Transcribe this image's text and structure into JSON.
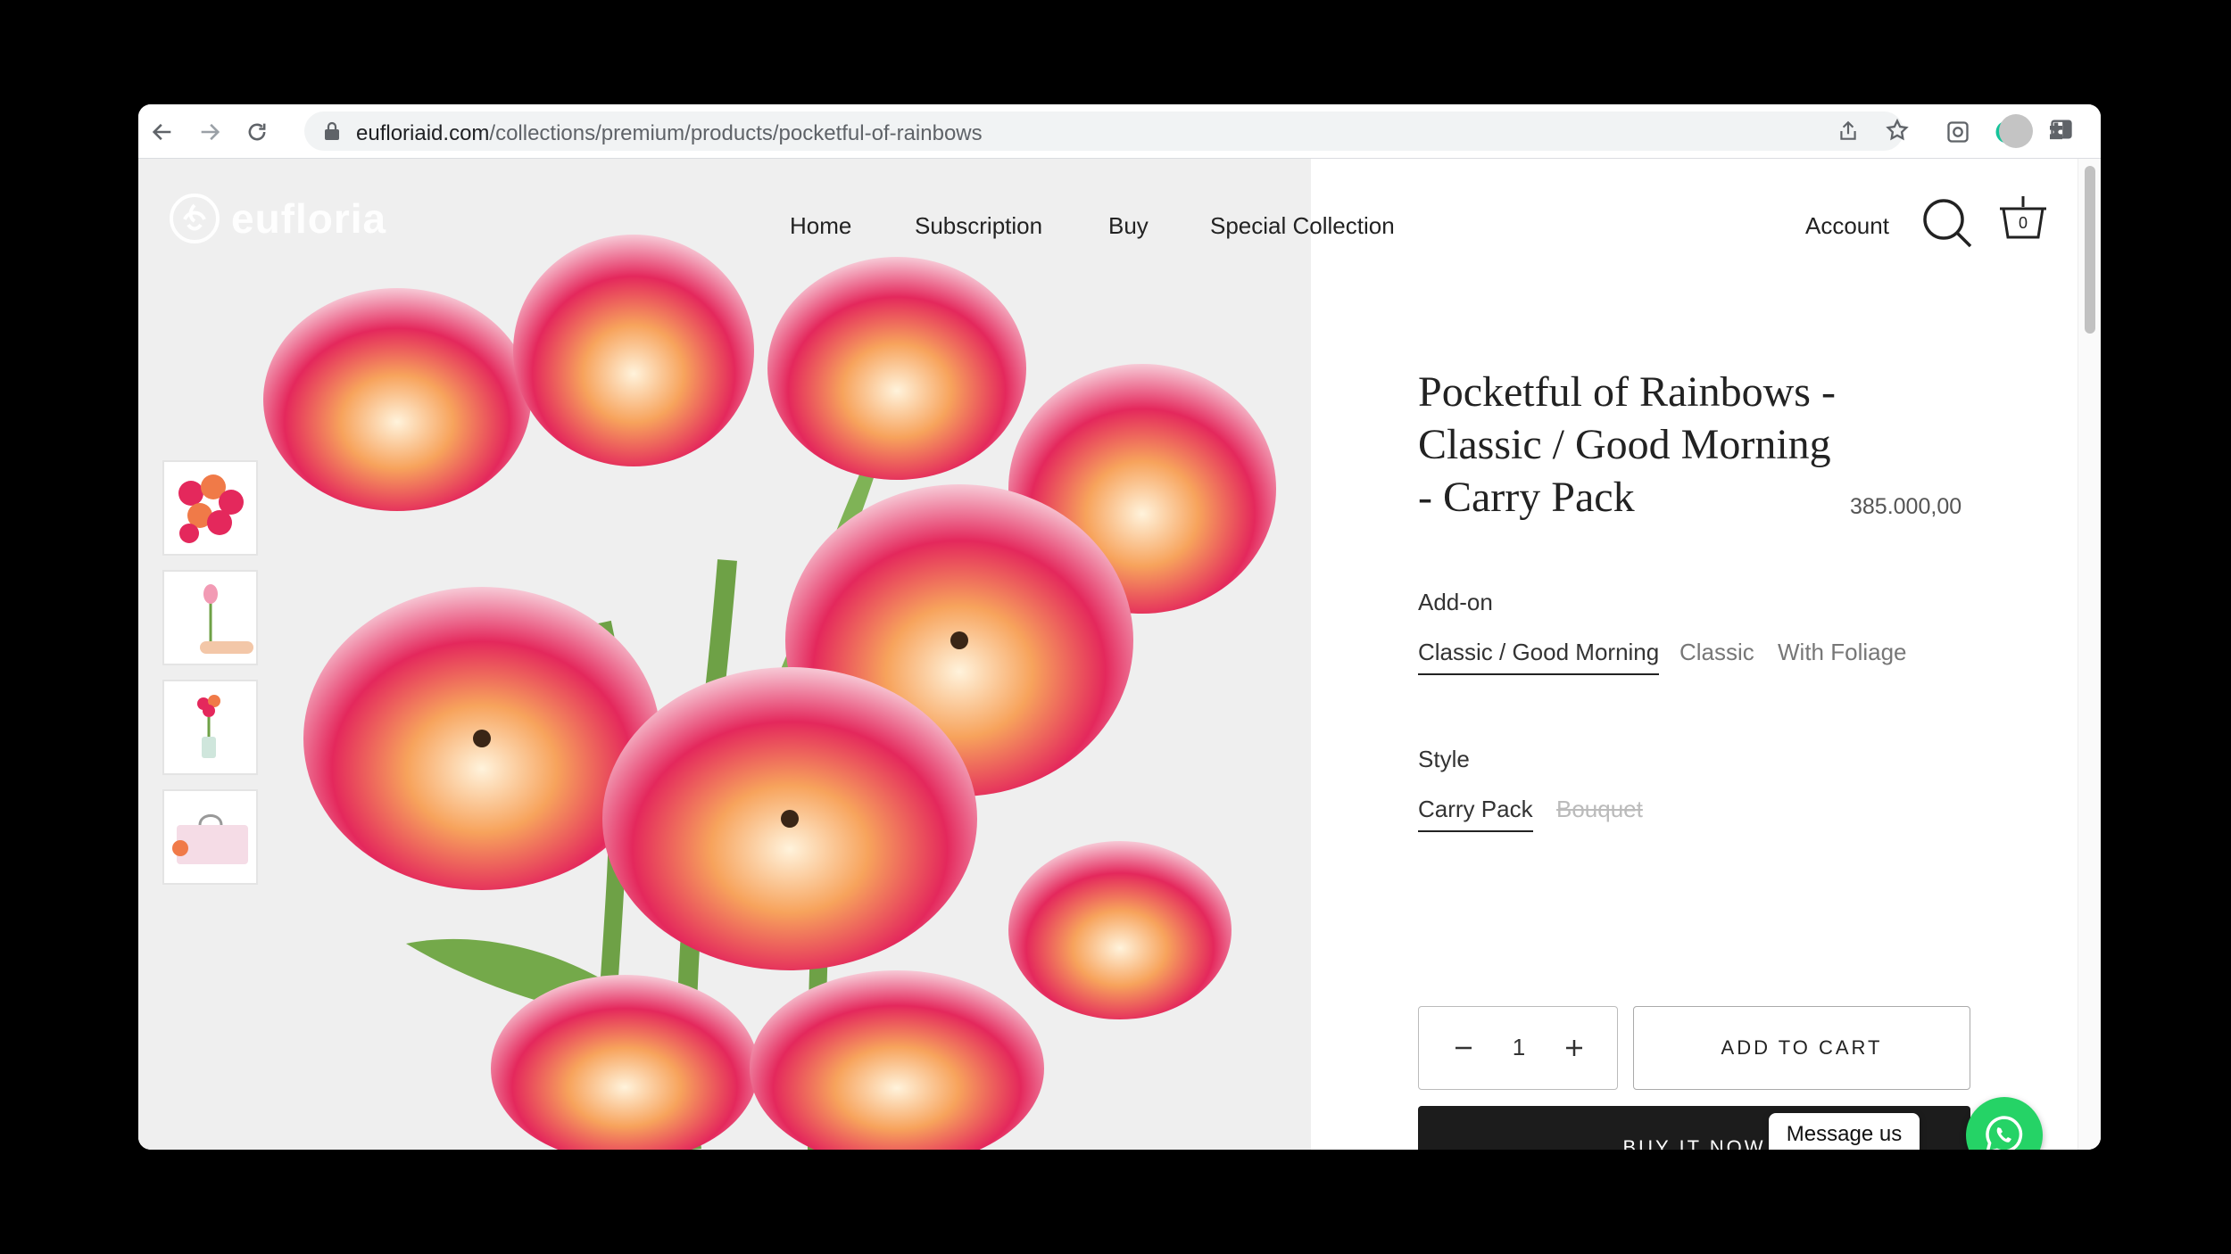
{
  "browser": {
    "url_host": "eufloriaid.com",
    "url_path": "/collections/premium/products/pocketful-of-rainbows",
    "icons": [
      "back-arrow-icon",
      "forward-arrow-icon",
      "reload-icon",
      "lock-icon",
      "share-icon",
      "star-icon",
      "extension-icon",
      "puzzle-icon",
      "sidebar-icon",
      "profile-avatar",
      "kebab-menu-icon"
    ]
  },
  "site": {
    "brand": "eufloria",
    "nav": [
      "Home",
      "Subscription",
      "Buy",
      "Special Collection"
    ],
    "account_label": "Account",
    "cart_count": "0"
  },
  "product": {
    "title": "Pocketful of Rainbows - Classic / Good Morning - Carry Pack",
    "price": "385.000,00",
    "addon_label": "Add-on",
    "addon_options": [
      "Classic / Good Morning",
      "Classic",
      "With Foliage"
    ],
    "addon_selected": 0,
    "style_label": "Style",
    "style_options": [
      "Carry Pack",
      "Bouquet"
    ],
    "style_selected": 0,
    "style_unavailable": [
      1
    ],
    "quantity": "1",
    "add_to_cart": "ADD TO CART",
    "buy_now": "BUY IT NOW",
    "thumbnail_count": 4
  },
  "chat": {
    "bubble": "Message us"
  },
  "colors": {
    "accent_dark": "#1c1c1c",
    "whatsapp": "#25d366",
    "tulip_pink": "#e8245a",
    "tulip_orange": "#f58a4d"
  }
}
